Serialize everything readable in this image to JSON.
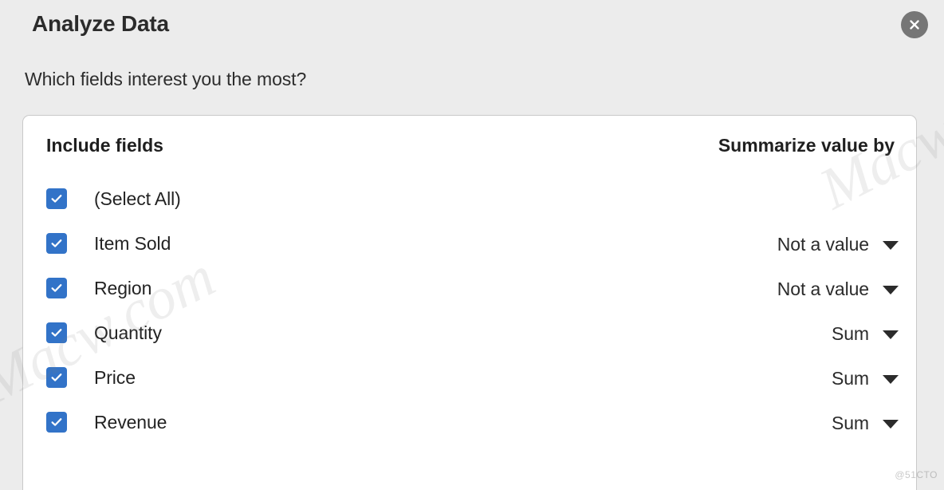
{
  "dialog": {
    "title": "Analyze Data",
    "subtitle": "Which fields interest you the most?",
    "close_icon": "close-icon"
  },
  "panel": {
    "headers": {
      "include": "Include fields",
      "summarize": "Summarize value by"
    },
    "rows": [
      {
        "label": "(Select All)",
        "checked": true,
        "summarize": ""
      },
      {
        "label": "Item Sold",
        "checked": true,
        "summarize": "Not a value"
      },
      {
        "label": "Region",
        "checked": true,
        "summarize": "Not a value"
      },
      {
        "label": "Quantity",
        "checked": true,
        "summarize": "Sum"
      },
      {
        "label": "Price",
        "checked": true,
        "summarize": "Sum"
      },
      {
        "label": "Revenue",
        "checked": true,
        "summarize": "Sum"
      }
    ]
  },
  "watermarks": {
    "left": "Macw.com",
    "right": "Macw.co",
    "corner": "@51CTO"
  },
  "colors": {
    "page_background": "#ececec",
    "panel_background": "#ffffff",
    "checkbox_accent": "#3273c8",
    "text_primary": "#232323",
    "close_button": "#767676"
  }
}
